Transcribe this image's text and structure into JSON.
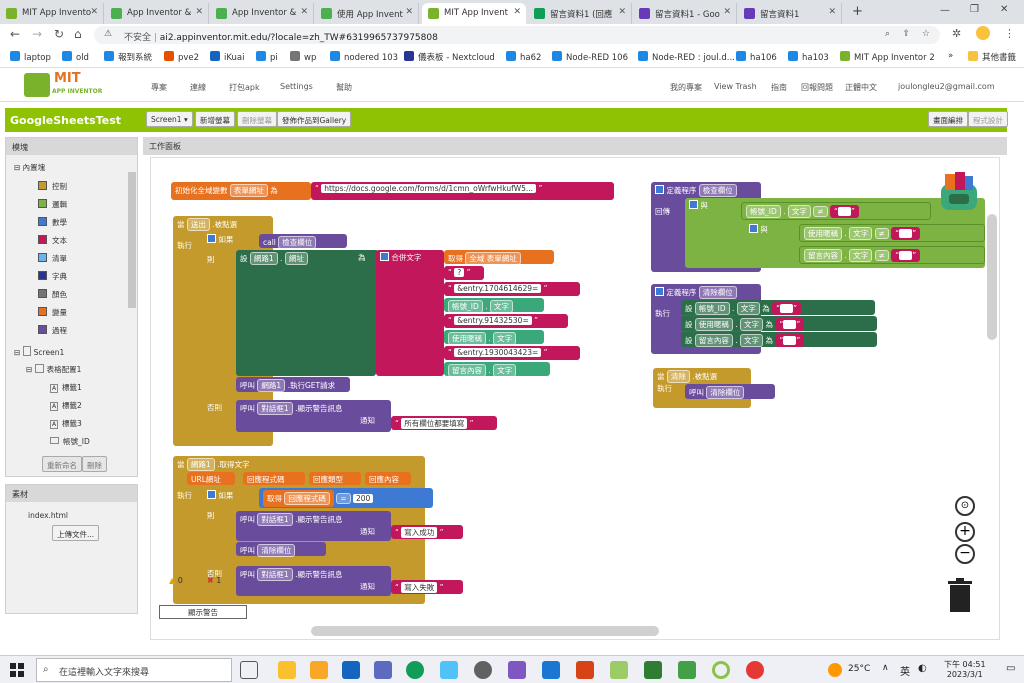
{
  "browser": {
    "tabs": [
      {
        "label": "MIT App Invento",
        "color": "#7ab32b"
      },
      {
        "label": "App Inventor &",
        "color": "#4caf50"
      },
      {
        "label": "App Inventor &",
        "color": "#4caf50"
      },
      {
        "label": "使用 App Invent",
        "color": "#4caf50"
      },
      {
        "label": "MIT App Invent",
        "color": "#7ab32b"
      },
      {
        "label": "留言資料1 (回應",
        "color": "#0f9d58"
      },
      {
        "label": "留言資料1 - Goo",
        "color": "#673ab7"
      },
      {
        "label": "留言資料1",
        "color": "#673ab7"
      }
    ],
    "new_tab": "+",
    "security_label": "不安全",
    "url": "ai2.appinventor.mit.edu/?locale=zh_TW#6319965737975808",
    "bookmarks": [
      {
        "label": "laptop",
        "color": "#1e88e5"
      },
      {
        "label": "old",
        "color": "#1e88e5"
      },
      {
        "label": "報到系統",
        "color": "#1e88e5"
      },
      {
        "label": "pve2",
        "color": "#e65100"
      },
      {
        "label": "iKuai",
        "color": "#1565c0"
      },
      {
        "label": "pi",
        "color": "#1e88e5"
      },
      {
        "label": "wp",
        "color": "#757575"
      },
      {
        "label": "nodered 103",
        "color": "#1e88e5"
      },
      {
        "label": "儀表板 - Nextcloud",
        "color": "#283593"
      },
      {
        "label": "ha62",
        "color": "#1e88e5"
      },
      {
        "label": "Node-RED 106",
        "color": "#1e88e5"
      },
      {
        "label": "Node-RED : joul.d...",
        "color": "#1e88e5"
      },
      {
        "label": "ha106",
        "color": "#1e88e5"
      },
      {
        "label": "ha103",
        "color": "#1e88e5"
      },
      {
        "label": "MIT App Inventor 2",
        "color": "#7ab32b"
      }
    ],
    "more_bookmarks": "其他書籤"
  },
  "app": {
    "logo_title": "MIT",
    "logo_subtitle": "APP INVENTOR",
    "menu": [
      "專案",
      "連線",
      "打包apk",
      "Settings",
      "幫助"
    ],
    "right_links": [
      "我的專案",
      "View Trash",
      "指南",
      "回報問題",
      "正體中文",
      "joulongleu2@gmail.com"
    ],
    "project_name": "GoogleSheetsTest",
    "screen_select": "Screen1",
    "project_buttons": {
      "add": "新增螢幕",
      "remove": "刪除螢幕",
      "gallery": "發佈作品到Gallery"
    },
    "view_buttons": {
      "designer": "畫面編排",
      "blocks": "程式設計"
    }
  },
  "blocks_panel": {
    "title": "模塊",
    "builtin": "內置塊",
    "categories": [
      {
        "label": "控制",
        "color": "#c49a2c"
      },
      {
        "label": "邏輯",
        "color": "#7cb342"
      },
      {
        "label": "數學",
        "color": "#3e7ad3"
      },
      {
        "label": "文本",
        "color": "#c2185b"
      },
      {
        "label": "清單",
        "color": "#64b5f6"
      },
      {
        "label": "字典",
        "color": "#283593"
      },
      {
        "label": "顏色",
        "color": "#757575"
      },
      {
        "label": "變量",
        "color": "#e8711f"
      },
      {
        "label": "過程",
        "color": "#6a4c9c"
      }
    ],
    "screen": "Screen1",
    "layout": "表格配置1",
    "labels": [
      "標籤1",
      "標籤2",
      "標籤3",
      "帳號_ID"
    ],
    "rename_button": "重新命名",
    "delete_button": "刪除"
  },
  "media_panel": {
    "title": "素材",
    "file": "index.html",
    "upload_button": "上傳文件..."
  },
  "workspace": {
    "title": "工作面板",
    "global": {
      "prefix": "初始化全域變數",
      "name": "表單網址",
      "to": "為",
      "value": "https://docs.google.com/forms/d/1cmn_oWrfwHkufW5..."
    },
    "submit_event": {
      "when": "當",
      "component": "送出",
      "event": ".被點選",
      "do": "執行",
      "if": "如果",
      "call": "call",
      "proc": "檢查欄位",
      "then": "則",
      "set": "設",
      "web": "網路1",
      "prop": "網址",
      "to": "為",
      "join": "合併文字",
      "get": "取得",
      "global_var": "全域 表單網址",
      "q": "?",
      "entry1": "&entry.1704614629=",
      "account": "帳號_ID",
      "text": "文字",
      "entry2": "&entry.91432530=",
      "user": "使用暱稱",
      "entry3": "&entry.1930043423=",
      "msg": "留言內容",
      "call_label": "呼叫",
      "get_req": ".執行GET請求",
      "else": "否則",
      "notifier": "對話框1",
      "alert": ".顯示警告訊息",
      "notice": "通知",
      "alert_text": "所有欄位都要填寫"
    },
    "got_text": {
      "when": "當",
      "web": "網路1",
      "event": ".取得文字",
      "params": [
        "URL網址",
        "回應程式碼",
        "回應類型",
        "回應內容"
      ],
      "do": "執行",
      "if": "如果",
      "get": "取得",
      "resp_code": "回應程式碼",
      "eq": "=",
      "value": "200",
      "then": "則",
      "call": "呼叫",
      "notifier": "對話框1",
      "alert": ".顯示警告訊息",
      "notice": "通知",
      "ok": "寫入成功",
      "clear": "清除欄位",
      "else": "否則",
      "fail": "寫入失敗"
    },
    "check_proc": {
      "def": "定義程序",
      "name": "檢查欄位",
      "ret": "回傳",
      "and": "與",
      "account": "帳號_ID",
      "text": "文字",
      "neq": "≠",
      "user": "使用暱稱",
      "msg": "留言內容"
    },
    "clear_proc": {
      "def": "定義程序",
      "name": "清除欄位",
      "do": "執行",
      "set": "設",
      "account": "帳號_ID",
      "user": "使用暱稱",
      "msg": "留言內容",
      "text": "文字",
      "to": "為"
    },
    "clear_event": {
      "when": "當",
      "component": "清除",
      "event": ".被點選",
      "do": "執行",
      "call": "呼叫",
      "proc": "清除欄位"
    },
    "warnings": {
      "warn_count": "0",
      "error_count": "1",
      "show_button": "顯示警告"
    }
  },
  "taskbar": {
    "search_placeholder": "在這裡輸入文字來搜尋",
    "weather": "25°C",
    "ime": "英",
    "time": "下午 04:51",
    "date": "2023/3/1"
  }
}
